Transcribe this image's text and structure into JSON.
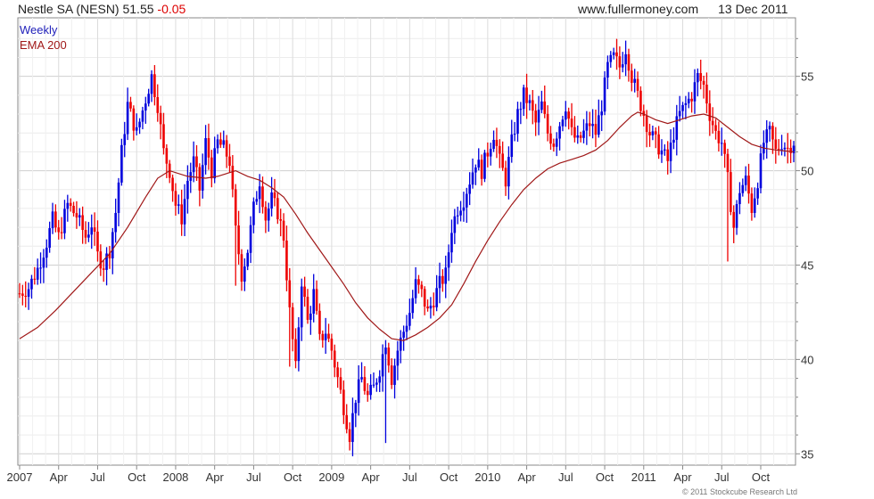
{
  "header": {
    "symbol": "Nestle SA (NESN)",
    "price": "51.55",
    "change": "-0.05",
    "site": "www.fullermoney.com",
    "date": "13 Dec 2011"
  },
  "footer": {
    "copyright": "© 2011 Stockcube Research Ltd"
  },
  "colors": {
    "up": "#0000dd",
    "down": "#ee0000",
    "ema": "#a01818",
    "grid": "#d8d8d8",
    "axis": "#888888"
  },
  "chart_data": {
    "type": "line",
    "subtype": "weekly-ohlc-bars-with-ema",
    "legend": [
      "Weekly",
      "EMA 200"
    ],
    "legend_position": "top-left",
    "y_axis_position": "right",
    "grid": true,
    "ylim": [
      34.4,
      58.1
    ],
    "y_ticks": [
      35,
      40,
      45,
      50,
      55
    ],
    "x_ticks": [
      "2007",
      "Apr",
      "Jul",
      "Oct",
      "2008",
      "Apr",
      "Jul",
      "Oct",
      "2009",
      "Apr",
      "Jul",
      "Oct",
      "2010",
      "Apr",
      "Jul",
      "Oct",
      "2011",
      "Apr",
      "Jul",
      "Oct"
    ],
    "x_tick_index": [
      0,
      13,
      26,
      39,
      52,
      65,
      78,
      91,
      104,
      117,
      130,
      143,
      156,
      169,
      182,
      195,
      208,
      221,
      234,
      247
    ],
    "weeks": 259,
    "series": [
      {
        "name": "Weekly",
        "anchors": [
          [
            0,
            43.5
          ],
          [
            3,
            43.8
          ],
          [
            6,
            44.8
          ],
          [
            9,
            46.2
          ],
          [
            11,
            47.4
          ],
          [
            13,
            46.5
          ],
          [
            16,
            48.2
          ],
          [
            19,
            47.6
          ],
          [
            22,
            46.5
          ],
          [
            24,
            47.2
          ],
          [
            26,
            45.5
          ],
          [
            28,
            45.0
          ],
          [
            30,
            45.8
          ],
          [
            32,
            47.8
          ],
          [
            34,
            51.0
          ],
          [
            36,
            53.5
          ],
          [
            39,
            52.0
          ],
          [
            42,
            53.8
          ],
          [
            44,
            55.0
          ],
          [
            46,
            53.5
          ],
          [
            48,
            51.0
          ],
          [
            50,
            50.0
          ],
          [
            52,
            48.2
          ],
          [
            54,
            47.5
          ],
          [
            56,
            49.5
          ],
          [
            58,
            50.5
          ],
          [
            60,
            49.0
          ],
          [
            62,
            51.5
          ],
          [
            64,
            50.0
          ],
          [
            66,
            51.5
          ],
          [
            68,
            51.2
          ],
          [
            70,
            50.5
          ],
          [
            72,
            46.8
          ],
          [
            74,
            44.5
          ],
          [
            76,
            45.8
          ],
          [
            78,
            48.0
          ],
          [
            80,
            49.5
          ],
          [
            82,
            47.5
          ],
          [
            84,
            48.5
          ],
          [
            86,
            47.8
          ],
          [
            88,
            46.5
          ],
          [
            90,
            42.5
          ],
          [
            92,
            39.5
          ],
          [
            94,
            44.2
          ],
          [
            96,
            42.0
          ],
          [
            98,
            43.5
          ],
          [
            100,
            41.0
          ],
          [
            102,
            41.5
          ],
          [
            104,
            40.5
          ],
          [
            106,
            39.0
          ],
          [
            108,
            37.5
          ],
          [
            110,
            36.0
          ],
          [
            112,
            38.0
          ],
          [
            114,
            39.0
          ],
          [
            116,
            38.0
          ],
          [
            118,
            38.5
          ],
          [
            120,
            39.5
          ],
          [
            122,
            41.0
          ],
          [
            124,
            39.0
          ],
          [
            126,
            40.5
          ],
          [
            128,
            41.5
          ],
          [
            130,
            42.5
          ],
          [
            132,
            44.0
          ],
          [
            134,
            43.5
          ],
          [
            136,
            42.5
          ],
          [
            138,
            43.2
          ],
          [
            140,
            44.0
          ],
          [
            142,
            44.5
          ],
          [
            144,
            47.0
          ],
          [
            146,
            48.0
          ],
          [
            148,
            48.5
          ],
          [
            150,
            49.5
          ],
          [
            152,
            50.5
          ],
          [
            154,
            50.0
          ],
          [
            156,
            51.0
          ],
          [
            158,
            52.0
          ],
          [
            160,
            50.5
          ],
          [
            162,
            49.5
          ],
          [
            164,
            51.5
          ],
          [
            166,
            53.0
          ],
          [
            168,
            54.0
          ],
          [
            170,
            53.5
          ],
          [
            172,
            52.5
          ],
          [
            174,
            53.5
          ],
          [
            176,
            52.0
          ],
          [
            178,
            51.5
          ],
          [
            180,
            52.5
          ],
          [
            182,
            53.5
          ],
          [
            184,
            52.0
          ],
          [
            186,
            51.5
          ],
          [
            188,
            52.0
          ],
          [
            190,
            52.5
          ],
          [
            192,
            52.0
          ],
          [
            194,
            53.5
          ],
          [
            196,
            55.5
          ],
          [
            198,
            56.0
          ],
          [
            200,
            55.5
          ],
          [
            202,
            56.5
          ],
          [
            204,
            55.0
          ],
          [
            206,
            54.0
          ],
          [
            208,
            53.0
          ],
          [
            210,
            52.0
          ],
          [
            212,
            51.5
          ],
          [
            214,
            51.0
          ],
          [
            216,
            50.5
          ],
          [
            218,
            52.0
          ],
          [
            220,
            53.0
          ],
          [
            222,
            53.5
          ],
          [
            224,
            54.0
          ],
          [
            226,
            55.0
          ],
          [
            228,
            54.5
          ],
          [
            230,
            53.0
          ],
          [
            232,
            52.0
          ],
          [
            234,
            51.5
          ],
          [
            236,
            49.5
          ],
          [
            238,
            47.0
          ],
          [
            240,
            49.0
          ],
          [
            242,
            49.5
          ],
          [
            244,
            48.0
          ],
          [
            246,
            49.5
          ],
          [
            248,
            51.5
          ],
          [
            250,
            52.0
          ],
          [
            252,
            51.0
          ],
          [
            254,
            51.5
          ],
          [
            256,
            51.2
          ],
          [
            258,
            51.55
          ]
        ]
      },
      {
        "name": "EMA 200",
        "points": [
          [
            0,
            41.1
          ],
          [
            6,
            41.7
          ],
          [
            12,
            42.6
          ],
          [
            18,
            43.6
          ],
          [
            24,
            44.6
          ],
          [
            30,
            45.6
          ],
          [
            36,
            47.0
          ],
          [
            42,
            48.6
          ],
          [
            46,
            49.6
          ],
          [
            50,
            50.0
          ],
          [
            56,
            49.7
          ],
          [
            62,
            49.6
          ],
          [
            66,
            49.7
          ],
          [
            72,
            50.0
          ],
          [
            76,
            49.7
          ],
          [
            80,
            49.5
          ],
          [
            84,
            49.1
          ],
          [
            88,
            48.6
          ],
          [
            92,
            47.7
          ],
          [
            96,
            46.7
          ],
          [
            100,
            45.8
          ],
          [
            104,
            44.9
          ],
          [
            108,
            44.0
          ],
          [
            112,
            43.0
          ],
          [
            116,
            42.2
          ],
          [
            120,
            41.6
          ],
          [
            124,
            41.1
          ],
          [
            128,
            41.0
          ],
          [
            132,
            41.3
          ],
          [
            136,
            41.7
          ],
          [
            140,
            42.2
          ],
          [
            144,
            42.9
          ],
          [
            148,
            44.0
          ],
          [
            152,
            45.2
          ],
          [
            156,
            46.3
          ],
          [
            160,
            47.3
          ],
          [
            164,
            48.2
          ],
          [
            168,
            49.0
          ],
          [
            172,
            49.6
          ],
          [
            176,
            50.1
          ],
          [
            180,
            50.4
          ],
          [
            184,
            50.6
          ],
          [
            188,
            50.8
          ],
          [
            192,
            51.1
          ],
          [
            196,
            51.6
          ],
          [
            200,
            52.3
          ],
          [
            204,
            52.9
          ],
          [
            206,
            53.1
          ],
          [
            208,
            53.0
          ],
          [
            212,
            52.7
          ],
          [
            216,
            52.5
          ],
          [
            220,
            52.7
          ],
          [
            224,
            52.9
          ],
          [
            228,
            53.0
          ],
          [
            232,
            52.8
          ],
          [
            236,
            52.3
          ],
          [
            240,
            51.8
          ],
          [
            244,
            51.4
          ],
          [
            248,
            51.2
          ],
          [
            252,
            51.1
          ],
          [
            258,
            51.0
          ]
        ]
      }
    ]
  }
}
